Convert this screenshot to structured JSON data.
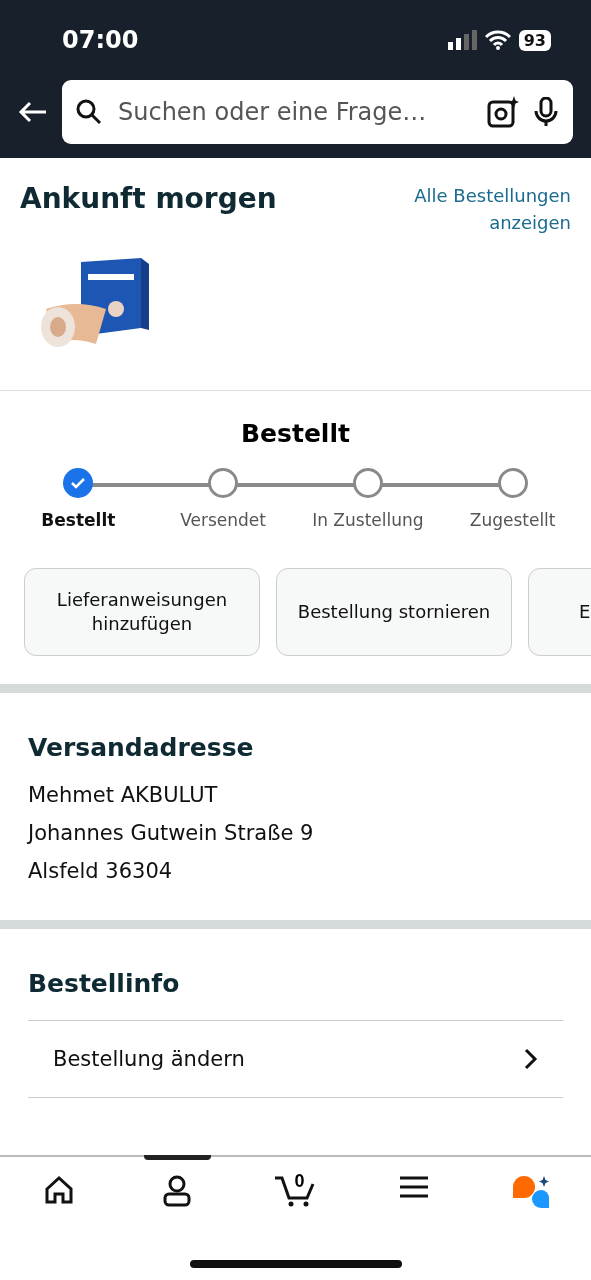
{
  "status_bar": {
    "time": "07:00",
    "battery": "93"
  },
  "search": {
    "placeholder": "Suchen oder eine Frage…"
  },
  "arrival": {
    "title": "Ankunft morgen",
    "link": "Alle Bestellungen anzeigen"
  },
  "tracker": {
    "title": "Bestellt",
    "steps": [
      {
        "label": "Bestellt",
        "done": true
      },
      {
        "label": "Versendet",
        "done": false
      },
      {
        "label": "In Zustellung",
        "done": false
      },
      {
        "label": "Zugestellt",
        "done": false
      }
    ]
  },
  "actions": [
    "Lieferanweisungen hinzufügen",
    "Bestellung stornieren",
    "E"
  ],
  "address": {
    "title": "Versandadresse",
    "lines": [
      "Mehmet AKBULUT",
      "Johannes Gutwein Straße 9",
      "Alsfeld 36304"
    ]
  },
  "order_info": {
    "title": "Bestellinfo",
    "items": [
      "Bestellung ändern"
    ]
  },
  "bottom_nav": {
    "cart_count": "0"
  }
}
